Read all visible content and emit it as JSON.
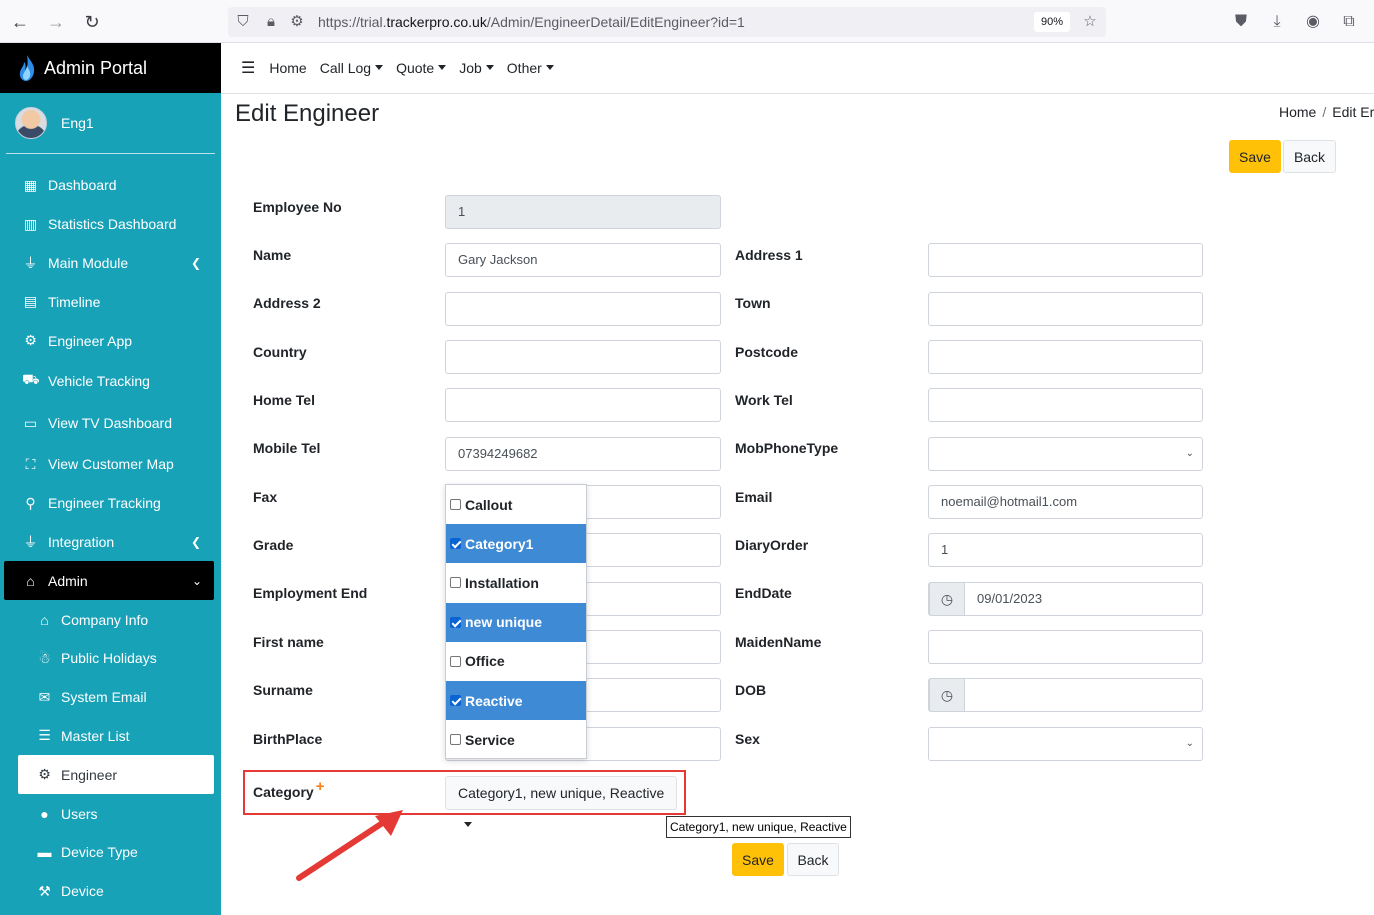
{
  "browser": {
    "url_prefix": "https://trial.",
    "url_domain": "trackerpro.co.uk",
    "url_path": "/Admin/EngineerDetail/EditEngineer?id=1",
    "zoom": "90%"
  },
  "sidebar": {
    "brand": "Admin Portal",
    "user": "Eng1",
    "items": [
      {
        "label": "Dashboard",
        "icon": "grid-icon"
      },
      {
        "label": "Statistics Dashboard",
        "icon": "bar-chart-icon"
      },
      {
        "label": "Main Module",
        "icon": "plug-icon"
      },
      {
        "label": "Timeline",
        "icon": "calendar-icon"
      },
      {
        "label": "Engineer App",
        "icon": "user-gear-icon"
      },
      {
        "label": "Vehicle Tracking",
        "icon": "driver-icon"
      },
      {
        "label": "View TV Dashboard",
        "icon": "monitor-icon"
      },
      {
        "label": "View Customer Map",
        "icon": "map-user-icon"
      },
      {
        "label": "Engineer Tracking",
        "icon": "map-pin-icon"
      },
      {
        "label": "Integration",
        "icon": "plug-icon"
      },
      {
        "label": "Admin",
        "icon": "bank-icon"
      }
    ],
    "subitems": [
      {
        "label": "Company Info",
        "icon": "home-icon"
      },
      {
        "label": "Public Holidays",
        "icon": "holiday-icon"
      },
      {
        "label": "System Email",
        "icon": "email-icon"
      },
      {
        "label": "Master List",
        "icon": "database-icon"
      },
      {
        "label": "Engineer",
        "icon": "user-gear-icon"
      },
      {
        "label": "Users",
        "icon": "user-icon"
      },
      {
        "label": "Device Type",
        "icon": "briefcase-icon"
      },
      {
        "label": "Device",
        "icon": "wrench-icon"
      }
    ]
  },
  "topnav": {
    "items": [
      "Home",
      "Call Log",
      "Quote",
      "Job",
      "Other"
    ]
  },
  "page": {
    "title": "Edit Engineer",
    "breadcrumb_home": "Home",
    "breadcrumb_current": "Edit Er",
    "save_label": "Save",
    "back_label": "Back"
  },
  "form": {
    "employee_no": {
      "label": "Employee No",
      "value": "1"
    },
    "name": {
      "label": "Name",
      "value": "Gary Jackson"
    },
    "address1": {
      "label": "Address 1",
      "value": ""
    },
    "address2": {
      "label": "Address 2",
      "value": ""
    },
    "town": {
      "label": "Town",
      "value": ""
    },
    "country": {
      "label": "Country",
      "value": ""
    },
    "postcode": {
      "label": "Postcode",
      "value": ""
    },
    "home_tel": {
      "label": "Home Tel",
      "value": ""
    },
    "work_tel": {
      "label": "Work Tel",
      "value": ""
    },
    "mobile_tel": {
      "label": "Mobile Tel",
      "value": "07394249682"
    },
    "mob_phone_type": {
      "label": "MobPhoneType",
      "value": ""
    },
    "fax": {
      "label": "Fax",
      "value": ""
    },
    "email": {
      "label": "Email",
      "value": "noemail@hotmail1.com"
    },
    "grade": {
      "label": "Grade",
      "value": ""
    },
    "diary_order": {
      "label": "DiaryOrder",
      "value": "1"
    },
    "employment_end": {
      "label": "Employment End",
      "value": ""
    },
    "end_date": {
      "label": "EndDate",
      "value": "09/01/2023"
    },
    "first_name": {
      "label": "First name",
      "value": ""
    },
    "maiden_name": {
      "label": "MaidenName",
      "value": ""
    },
    "surname": {
      "label": "Surname",
      "value": ""
    },
    "dob": {
      "label": "DOB",
      "value": ""
    },
    "birth_place": {
      "label": "BirthPlace",
      "value": ""
    },
    "sex": {
      "label": "Sex",
      "value": ""
    },
    "category": {
      "label": "Category",
      "required_mark": "+",
      "selected_text": "Category1, new unique, Reactive",
      "tooltip": "Category1, new unique, Reactive",
      "options": [
        {
          "label": "Callout",
          "checked": false
        },
        {
          "label": "Category1",
          "checked": true
        },
        {
          "label": "Installation",
          "checked": false
        },
        {
          "label": "new unique",
          "checked": true
        },
        {
          "label": "Office",
          "checked": false
        },
        {
          "label": "Reactive",
          "checked": true
        },
        {
          "label": "Service",
          "checked": false
        }
      ]
    }
  },
  "colors": {
    "sidebar": "#17a2b8",
    "save": "#ffc107",
    "option_checked": "#3f8ad4",
    "annotation": "#e53935"
  }
}
